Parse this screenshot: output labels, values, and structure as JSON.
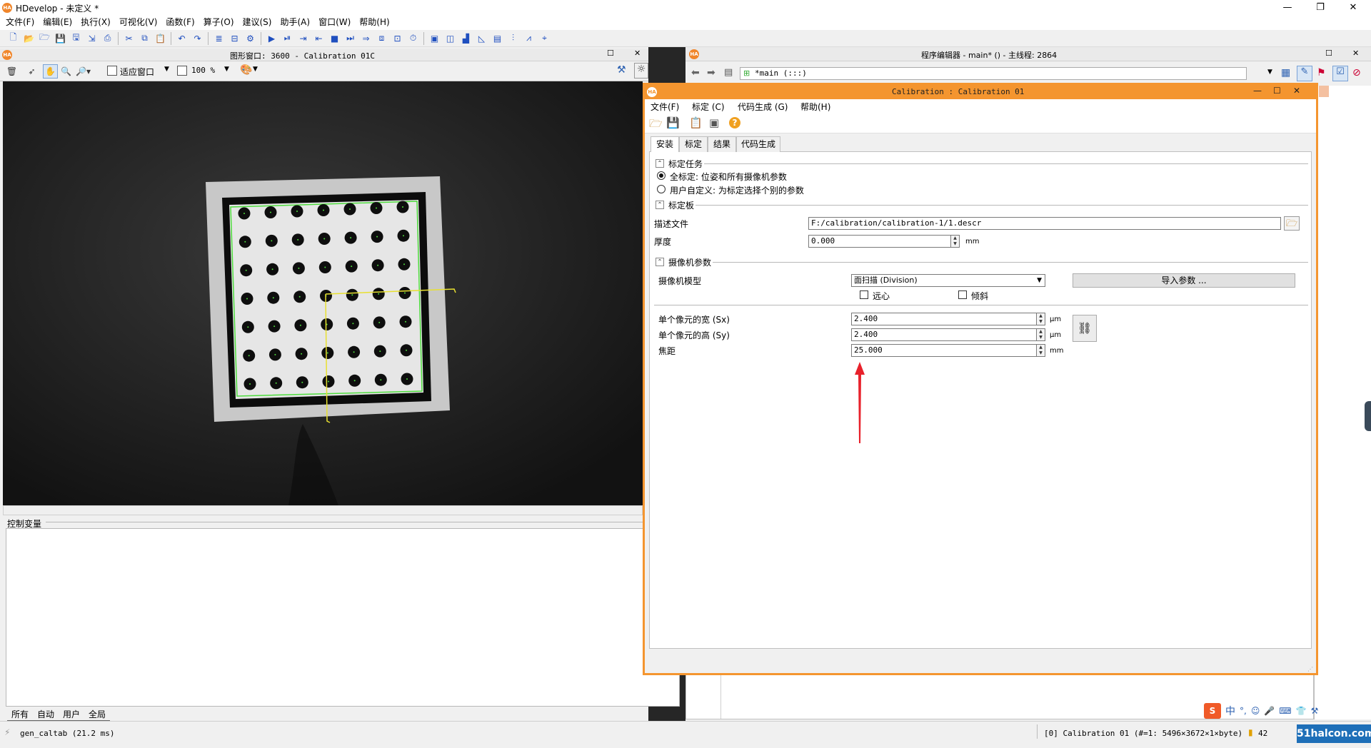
{
  "app": {
    "title": "HDevelop - 未定义 *",
    "logo": "HA"
  },
  "menubar": [
    "文件(F)",
    "编辑(E)",
    "执行(X)",
    "可视化(V)",
    "函数(F)",
    "算子(O)",
    "建议(S)",
    "助手(A)",
    "窗口(W)",
    "帮助(H)"
  ],
  "graphics_window": {
    "title": "图形窗口: 3600 - Calibration 01C",
    "zoom_mode": "适应窗口",
    "zoom_percent": "100 %"
  },
  "control_variables": {
    "title": "控制变量",
    "tabs": [
      "所有",
      "自动",
      "用户",
      "全局"
    ]
  },
  "program_editor": {
    "title": "程序编辑器 - main* () - 主线程: 2864",
    "procedure": "*main (:::)"
  },
  "calibration": {
    "title": "Calibration : Calibration 01",
    "menu": [
      "文件(F)",
      "标定 (C)",
      "代码生成 (G)",
      "帮助(H)"
    ],
    "tabs": [
      "安装",
      "标定",
      "结果",
      "代码生成"
    ],
    "task": {
      "header": "标定任务",
      "opt_full": "全标定: 位姿和所有摄像机参数",
      "opt_user": "用户自定义: 为标定选择个别的参数",
      "selected": "full"
    },
    "plate": {
      "header": "标定板",
      "desc_label": "描述文件",
      "desc_value": "F:/calibration/calibration-1/1.descr",
      "thickness_label": "厚度",
      "thickness_value": "0.000",
      "thickness_unit": "mm"
    },
    "camera": {
      "header": "摄像机参数",
      "model_label": "摄像机模型",
      "model_value": "面扫描 (Division)",
      "import_button": "导入参数 ...",
      "telecentric_label": "远心",
      "tilt_label": "倾斜",
      "sx_label": "单个像元的宽 (Sx)",
      "sx_value": "2.400",
      "sx_unit": "μm",
      "sy_label": "单个像元的高 (Sy)",
      "sy_value": "2.400",
      "sy_unit": "μm",
      "focal_label": "焦距",
      "focal_value": "25.000",
      "focal_unit": "mm"
    }
  },
  "status": {
    "left": "gen_caltab (21.2 ms)",
    "right": "[0] Calibration 01 (#=1: 5496×3672×1×byte)",
    "count": "42",
    "watermark": "51halcon.com"
  },
  "ime": {
    "label": "中"
  },
  "colors": {
    "accent": "#f4952f",
    "annotation_arrow": "#e8212b",
    "contour": "#4ddc3c",
    "axis": "#e8e030"
  }
}
